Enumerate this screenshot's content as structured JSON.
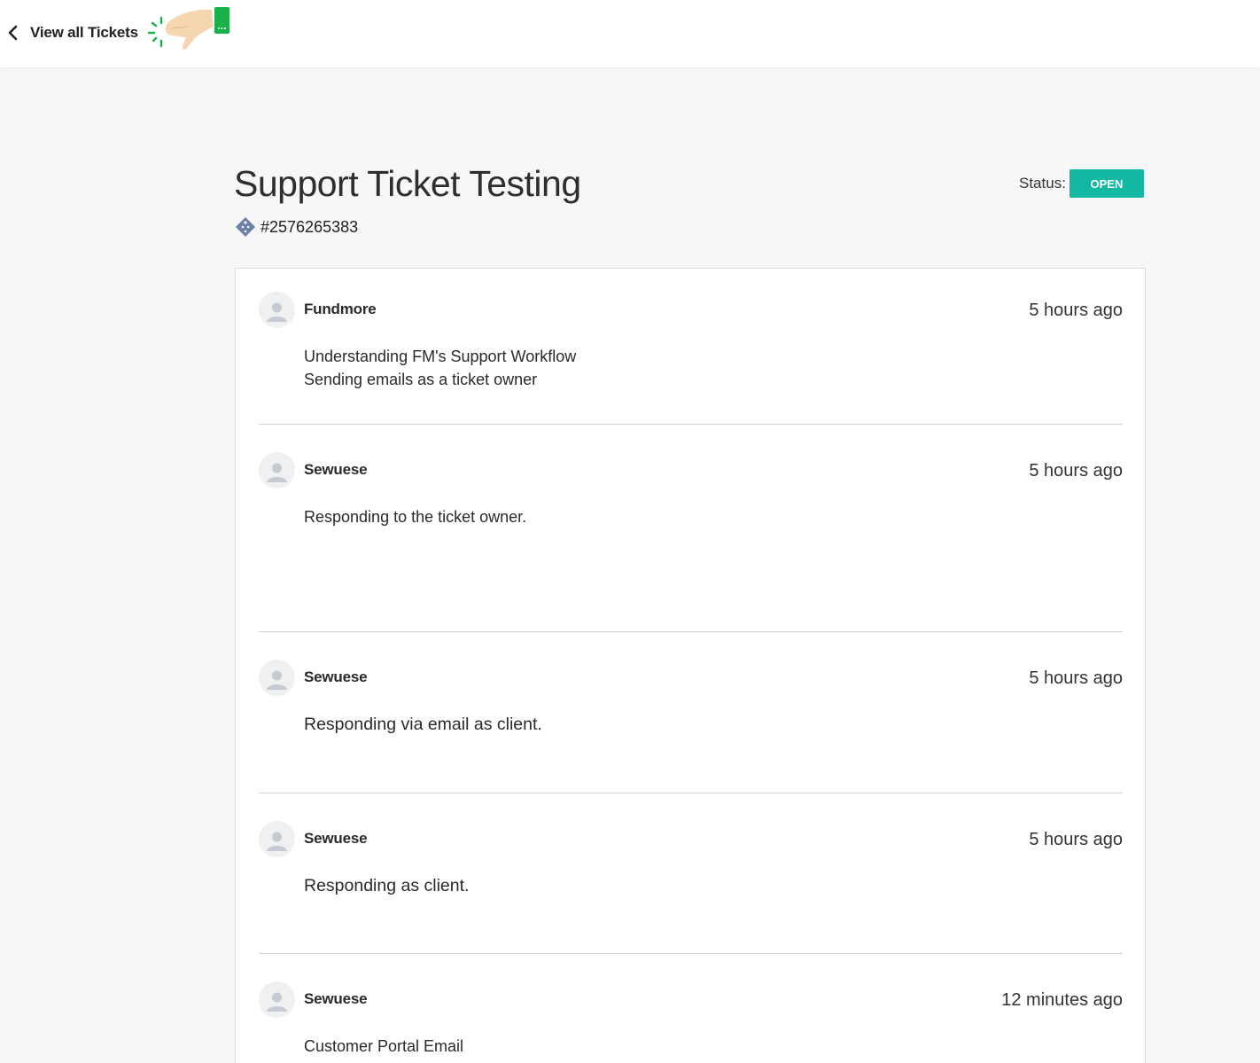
{
  "nav": {
    "back_label": "View all Tickets"
  },
  "ticket": {
    "title": "Support Ticket Testing",
    "number": "#2576265383",
    "status_label": "Status:",
    "status_value": "OPEN",
    "status_color": "#12b8a2"
  },
  "messages": [
    {
      "author": "Fundmore",
      "time": "5 hours ago",
      "lines": [
        "Understanding FM's Support Workflow",
        "Sending emails as a ticket owner"
      ]
    },
    {
      "author": "Sewuese",
      "time": "5 hours ago",
      "lines": [
        "Responding to the ticket owner."
      ]
    },
    {
      "author": "Sewuese",
      "time": "5 hours ago",
      "lines": [
        "Responding via email as client."
      ]
    },
    {
      "author": "Sewuese",
      "time": "5 hours ago",
      "lines": [
        "Responding as client."
      ]
    },
    {
      "author": "Sewuese",
      "time": "12 minutes ago",
      "lines": [
        "Customer Portal Email"
      ]
    }
  ],
  "icons": {
    "back": "chevron-left-icon",
    "ticket": "ticket-tag-icon",
    "avatar": "user-avatar-icon",
    "pointer": "hand-pointer-icon"
  }
}
